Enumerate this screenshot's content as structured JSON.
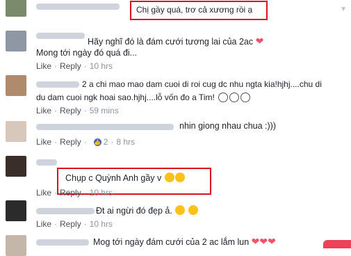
{
  "actions": {
    "like": "Like",
    "reply": "Reply",
    "dot": "·"
  },
  "comments": [
    {
      "text": "Chị gầy quá, trơ cả xương rồi ạ",
      "time": ""
    },
    {
      "line1": "Hãy nghĩ đó là đám cưới tương lai của 2ac",
      "line2": "Mong tới ngày đó quá đi...",
      "time": "10 hrs"
    },
    {
      "line1": "2 a chi mao mao dam cuoi di roi cug dc nhu ngta kia!hjhj....chu di",
      "line2": "du dam cuoi ngk hoai sao.hjhj....lỗ vốn đo a Tim!",
      "time": "59 mins"
    },
    {
      "text": "nhin giong nhau chua :)))",
      "likes": "2",
      "time": "8 hrs"
    },
    {
      "text": "Chụp c Quỳnh Anh gầy v",
      "time": "10 hrs"
    },
    {
      "text": "Đt ai ngừi đó đẹp ả.",
      "time": "10 hrs"
    },
    {
      "text": "Mog tới ngày đám cưới của 2 ac lắm lun"
    }
  ],
  "colors": {
    "highlight": "#d9141e",
    "link": "#4b4f56",
    "muted": "#90949c",
    "heart": "#f25268"
  },
  "icons": {
    "chevron": "chevron-down-icon",
    "like_badge": "thumbs-up-icon",
    "heart": "heart-icon",
    "emoji_tears": "tears-of-joy-emoji",
    "emoji_grin": "grinning-emoji",
    "emoji_outline": "face-outline-emoji"
  }
}
